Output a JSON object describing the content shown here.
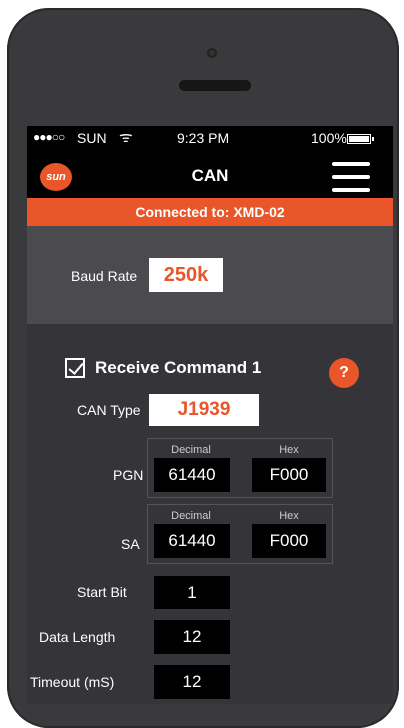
{
  "status_bar": {
    "signal": "●●●○○",
    "carrier": "SUN",
    "wifi_icon": "wifi-icon",
    "time": "9:23 PM",
    "battery": "100%"
  },
  "nav": {
    "logo_text": "sun",
    "title": "CAN",
    "menu_icon": "hamburger-menu-icon"
  },
  "banner": {
    "text": "Connected to: XMD-02"
  },
  "baud": {
    "label": "Baud Rate",
    "value": "250k"
  },
  "command": {
    "checkbox_checked": true,
    "title": "Receive Command 1",
    "help": "?",
    "can_type_label": "CAN Type",
    "can_type_value": "J1939",
    "pgn": {
      "label": "PGN",
      "decimal_header": "Decimal",
      "hex_header": "Hex",
      "decimal": "61440",
      "hex": "F000"
    },
    "sa": {
      "label": "SA",
      "decimal_header": "Decimal",
      "hex_header": "Hex",
      "decimal": "61440",
      "hex": "F000"
    },
    "start_bit": {
      "label": "Start Bit",
      "value": "1"
    },
    "data_length": {
      "label": "Data Length",
      "value": "12"
    },
    "timeout": {
      "label": "Timeout (mS)",
      "value": "12"
    }
  },
  "colors": {
    "accent": "#e8562a",
    "background": "#353539",
    "panel": "#4b4b4f",
    "bar": "#000000"
  }
}
